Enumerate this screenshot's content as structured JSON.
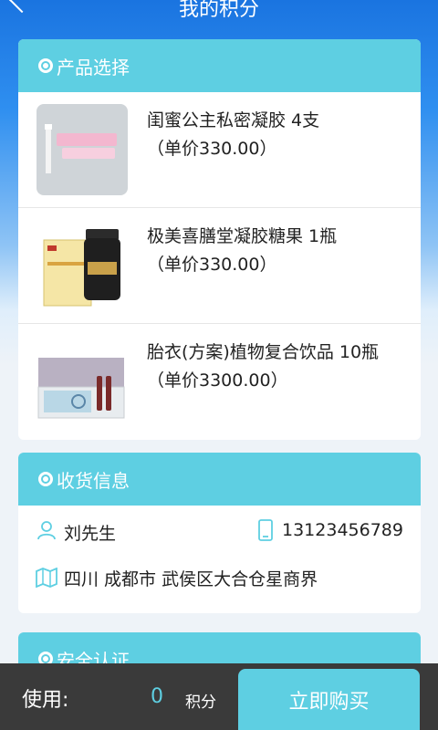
{
  "header": {
    "title": "我的积分"
  },
  "products_section": {
    "title": "产品选择",
    "items": [
      {
        "name": "闺蜜公主私密凝胶 4支",
        "price": "（单价330.00）"
      },
      {
        "name": "极美喜膳堂凝胶糖果 1瓶",
        "price": "（单价330.00）"
      },
      {
        "name": "胎衣(方案)植物复合饮品 10瓶",
        "price": "（单价3300.00）"
      }
    ]
  },
  "shipping_section": {
    "title": "收货信息",
    "name": "刘先生",
    "phone": "13123456789",
    "address": "四川 成都市 武侯区大合仓星商界"
  },
  "security_section": {
    "title": "安全认证"
  },
  "footer": {
    "use_label": "使用:",
    "points_value": "0",
    "points_unit": "积分",
    "buy_label": "立即购买"
  },
  "colors": {
    "accent": "#5ecfe2",
    "bottom_bar": "#3a3a3a"
  }
}
